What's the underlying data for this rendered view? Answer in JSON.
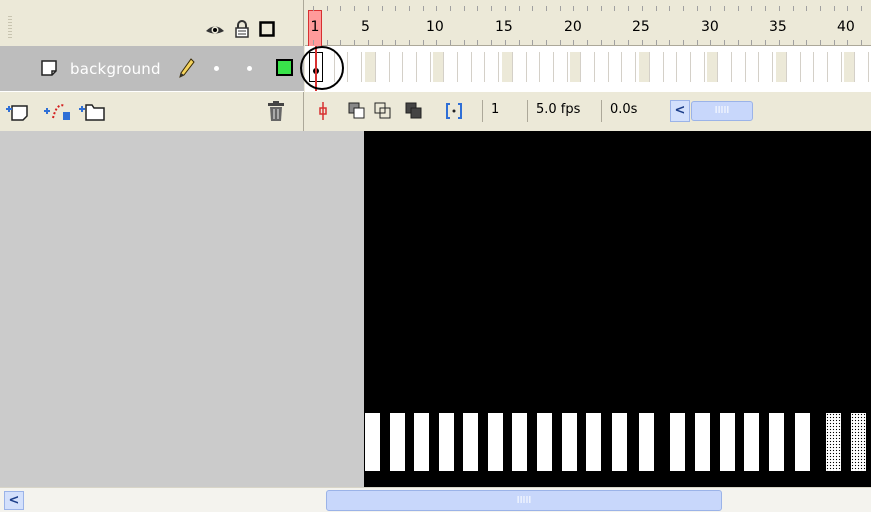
{
  "timeline": {
    "header_icons": [
      "eye-icon",
      "lock-icon",
      "outline-icon"
    ],
    "ruler_numbers": [
      "1",
      "5",
      "10",
      "15",
      "20",
      "25",
      "30",
      "35",
      "40"
    ],
    "layer": {
      "name": "background",
      "color": "#39e34a"
    },
    "toolbar_left_icons": [
      "insert-layer-icon",
      "add-motion-guide-icon",
      "insert-folder-icon",
      "trash-icon"
    ],
    "toolbar_right": {
      "icons": [
        "center-frame-icon",
        "onion-skin-icon",
        "onion-skin-outlines-icon",
        "edit-multiple-frames-icon",
        "modify-onion-markers-icon"
      ],
      "current_frame": "1",
      "frame_rate": "5.0 fps",
      "elapsed_time": "0.0s"
    }
  },
  "stage": {
    "canvas_color": "#000000",
    "pasteboard_color": "#cbcbcb"
  },
  "colors": {
    "playhead": "#ff9a9a",
    "scroll_blue": "#c8d7fb"
  }
}
